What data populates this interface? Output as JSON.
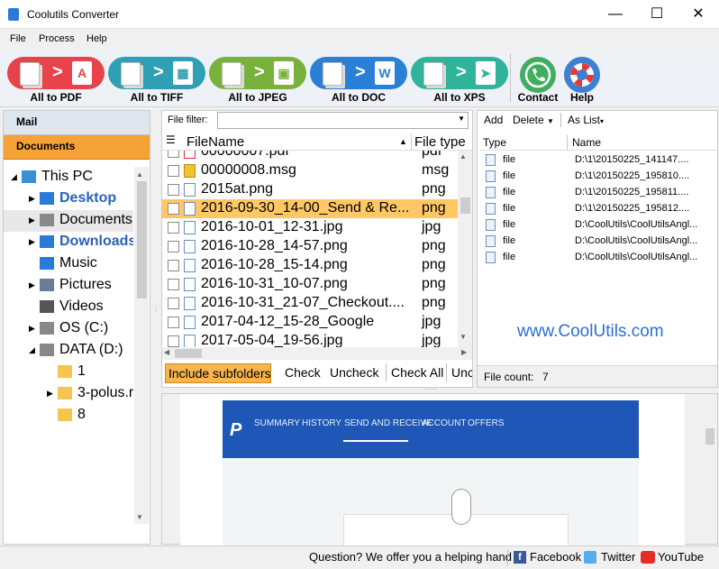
{
  "window": {
    "title": "Coolutils Converter",
    "minimize": "—",
    "maximize": "☐",
    "close": "✕"
  },
  "menu": [
    "File",
    "Process",
    "Help"
  ],
  "toolbar": {
    "buttons": [
      {
        "label": "All to PDF",
        "color": "#e8434b",
        "target": "A"
      },
      {
        "label": "All to TIFF",
        "color": "#2e9fb4",
        "target": "▦"
      },
      {
        "label": "All to JPEG",
        "color": "#78b23c",
        "target": "▣"
      },
      {
        "label": "All to DOC",
        "color": "#2a7fd6",
        "target": "W"
      },
      {
        "label": "All to XPS",
        "color": "#2fb39b",
        "target": "➤"
      }
    ],
    "contact": "Contact",
    "help": "Help"
  },
  "nav": {
    "mail": "Mail",
    "documents": "Documents"
  },
  "tree": [
    {
      "label": "This PC",
      "icon": "computer-icon",
      "exp": "◢"
    },
    {
      "label": "Desktop",
      "icon": "desktop-icon",
      "exp": "▶",
      "bold": true
    },
    {
      "label": "Documents",
      "icon": "documents-icon",
      "exp": "▶"
    },
    {
      "label": "Downloads",
      "icon": "download-icon",
      "exp": "▶",
      "bold": true
    },
    {
      "label": "Music",
      "icon": "music-icon",
      "exp": ""
    },
    {
      "label": "Pictures",
      "icon": "pictures-icon",
      "exp": "▶"
    },
    {
      "label": "Videos",
      "icon": "videos-icon",
      "exp": ""
    },
    {
      "label": "OS (C:)",
      "icon": "drive-icon",
      "exp": "▶"
    },
    {
      "label": "DATA (D:)",
      "icon": "drive-icon",
      "exp": "◢"
    },
    {
      "label": "1",
      "icon": "folder-icon",
      "exp": ""
    },
    {
      "label": "3-polus.ru",
      "icon": "folder-icon",
      "exp": "▶"
    },
    {
      "label": "8",
      "icon": "folder-icon",
      "exp": ""
    }
  ],
  "filefilter": {
    "label": "File filter:",
    "value": ""
  },
  "filelist": {
    "col_name": "FileName",
    "col_type": "File type",
    "rows": [
      {
        "name": "00000007.pdf",
        "type": "pdf"
      },
      {
        "name": "00000008.msg",
        "type": "msg"
      },
      {
        "name": "2015at.png",
        "type": "png"
      },
      {
        "name": "2016-09-30_14-00_Send & Re...",
        "type": "png",
        "selected": true
      },
      {
        "name": "2016-10-01_12-31.jpg",
        "type": "jpg"
      },
      {
        "name": "2016-10-28_14-57.png",
        "type": "png"
      },
      {
        "name": "2016-10-28_15-14.png",
        "type": "png"
      },
      {
        "name": "2016-10-31_10-07.png",
        "type": "png"
      },
      {
        "name": "2016-10-31_21-07_Checkout....",
        "type": "png"
      },
      {
        "name": "2017-04-12_15-28_Google",
        "type": "jpg"
      },
      {
        "name": "2017-05-04_19-56.jpg",
        "type": "jpg"
      }
    ]
  },
  "filebuttons": {
    "include": "Include subfolders",
    "check": "Check",
    "uncheck": "Uncheck",
    "checkall": "Check All",
    "uncheckall": "Uncheck All"
  },
  "rightpanel": {
    "add": "Add",
    "delete": "Delete",
    "aslist": "As List",
    "col_type": "Type",
    "col_name": "Name",
    "rows": [
      {
        "type": "file",
        "name": "D:\\1\\20150225_141147...."
      },
      {
        "type": "file",
        "name": "D:\\1\\20150225_195810...."
      },
      {
        "type": "file",
        "name": "D:\\1\\20150225_195811...."
      },
      {
        "type": "file",
        "name": "D:\\1\\20150225_195812...."
      },
      {
        "type": "file",
        "name": "D:\\CoolUtils\\CoolUtilsAngl..."
      },
      {
        "type": "file",
        "name": "D:\\CoolUtils\\CoolUtilsAngl..."
      },
      {
        "type": "file",
        "name": "D:\\CoolUtils\\CoolUtilsAngl..."
      }
    ],
    "website": "www.CoolUtils.com",
    "filecount_label": "File count:",
    "filecount": "7"
  },
  "preview": {
    "nav": [
      "SUMMARY",
      "HISTORY",
      "SEND AND RECEIVE",
      "ACCOUNT",
      "OFFERS"
    ]
  },
  "status": {
    "question": "Question? We offer you a helping hand -",
    "facebook": "Facebook",
    "twitter": "Twitter",
    "youtube": "YouTube"
  }
}
